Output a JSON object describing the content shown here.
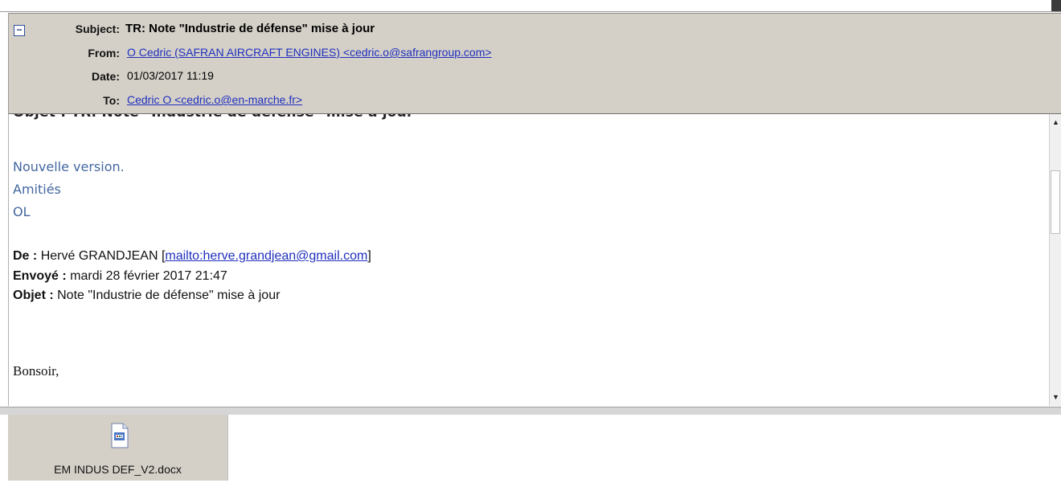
{
  "header": {
    "subject_label": "Subject:",
    "subject_value": "TR: Note \"Industrie de défense\" mise à jour",
    "from_label": "From:",
    "from_value": "O Cedric (SAFRAN AIRCRAFT ENGINES) <cedric.o@safrangroup.com>",
    "date_label": "Date:",
    "date_value": "01/03/2017 11:19",
    "to_label": "To:",
    "to_value": "Cedric O <cedric.o@en-marche.fr>",
    "collapse_symbol": "−"
  },
  "body": {
    "clipped_line": "Objet : TR: Note \"Industrie de défense\" mise à jour",
    "line_nouvelle": "Nouvelle version.",
    "line_amities": "Amitiés",
    "line_ol": "OL",
    "de_label": "De :",
    "de_value": "Hervé GRANDJEAN [",
    "de_link": "mailto:herve.grandjean@gmail.com",
    "de_end": "]",
    "envoye_label": "Envoyé :",
    "envoye_value": "mardi 28 février 2017 21:47",
    "objet_label": "Objet :",
    "objet_value": "Note \"Industrie de défense\" mise à jour",
    "greeting": "Bonsoir,"
  },
  "attachment": {
    "filename": "EM INDUS DEF_V2.docx",
    "icon": "docx-file-icon"
  },
  "colors": {
    "header_bg": "#d4d0c8",
    "link": "#1f2fbd",
    "body_blue": "#43679f"
  }
}
